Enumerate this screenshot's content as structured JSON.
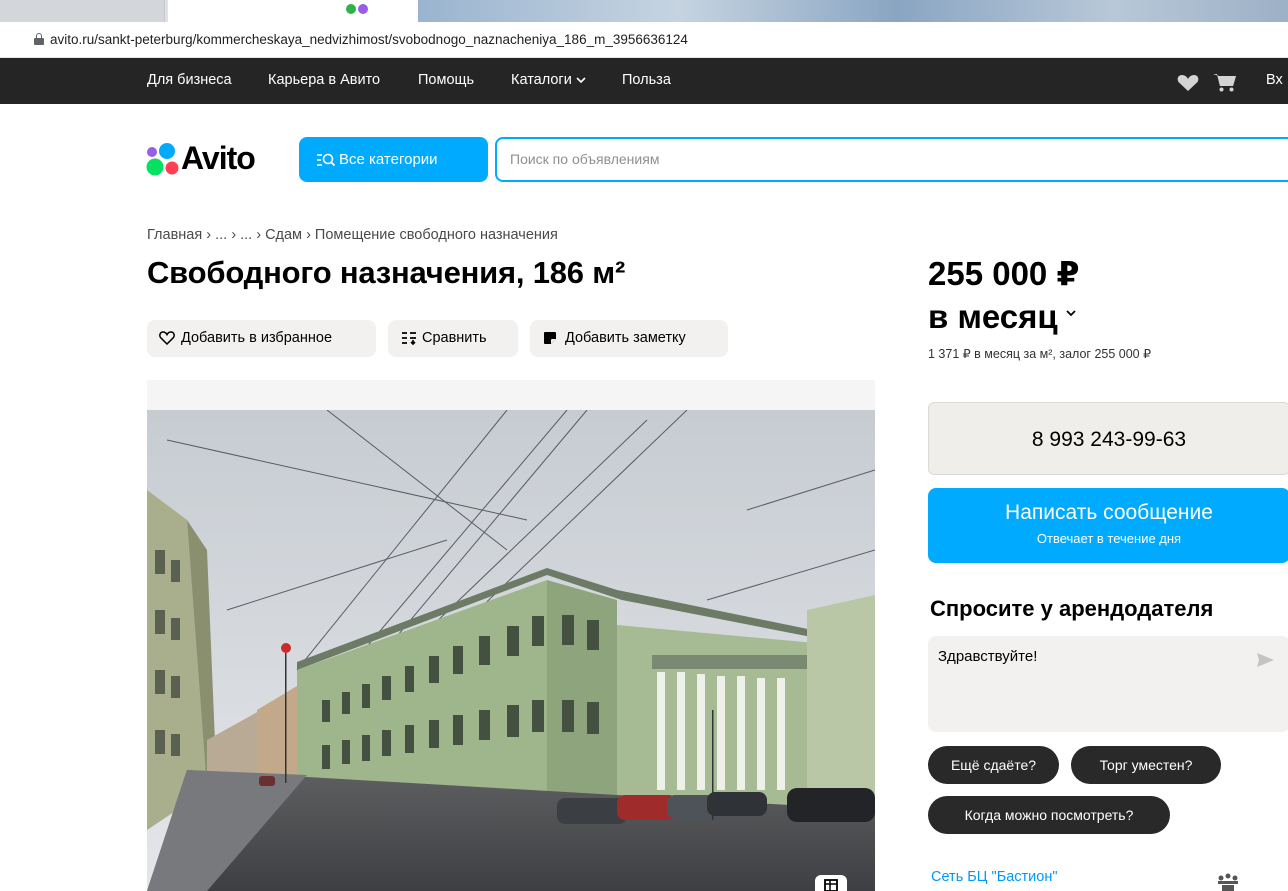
{
  "browser": {
    "url": "avito.ru/sankt-peterburg/kommercheskaya_nedvizhimost/svobodnogo_naznacheniya_186_m_3956636124"
  },
  "topnav": {
    "items": [
      "Для бизнеса",
      "Карьера в Авито",
      "Помощь",
      "Каталоги",
      "Польза"
    ],
    "login": "Вх"
  },
  "header": {
    "logo": "Avito",
    "categories_button": "Все категории",
    "search_placeholder": "Поиск по объявлениям"
  },
  "breadcrumb": [
    "Главная",
    "...",
    "...",
    "Сдам",
    "Помещение свободного назначения"
  ],
  "listing": {
    "title": "Свободного назначения, 186 м²",
    "actions": {
      "favorite": "Добавить в избранное",
      "compare": "Сравнить",
      "note": "Добавить заметку"
    }
  },
  "price": {
    "amount": "255 000 ₽",
    "period": "в месяц",
    "details": "1 371 ₽ в месяц за м², залог 255 000 ₽"
  },
  "contact": {
    "phone": "8 993 243-99-63",
    "message_button": "Написать сообщение",
    "message_sub": "Отвечает в течение дня"
  },
  "ask": {
    "title": "Спросите у арендодателя",
    "message_value": "Здравствуйте!",
    "chips": [
      "Ещё сдаёте?",
      "Торг уместен?",
      "Когда можно посмотреть?"
    ]
  },
  "seller": {
    "name": "Сеть БЦ \"Бастион\""
  },
  "colors": {
    "accent": "#00aaff",
    "nav_bg": "#252525",
    "chip_bg": "#292929",
    "link": "#0099f7"
  }
}
